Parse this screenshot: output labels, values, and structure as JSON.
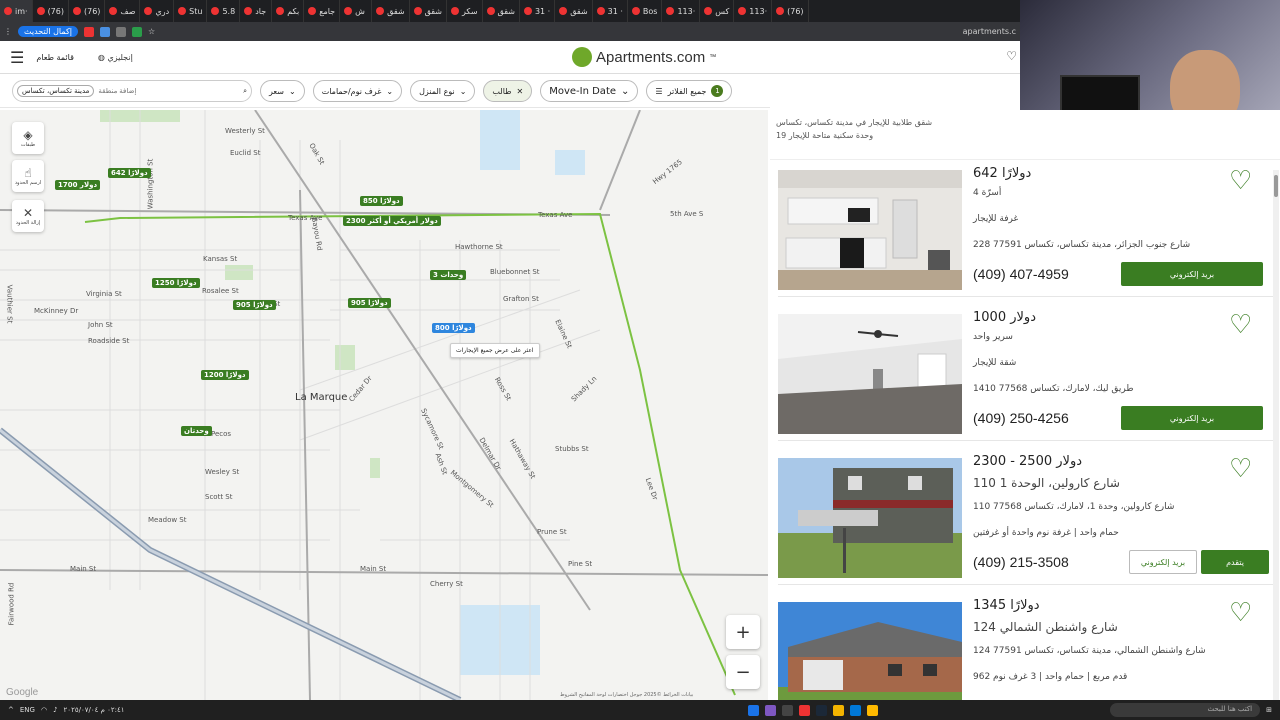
{
  "browser": {
    "tabs": [
      {
        "label": "im·"
      },
      {
        "label": "(76)"
      },
      {
        "label": "(76)"
      },
      {
        "label": "صف"
      },
      {
        "label": "دري"
      },
      {
        "label": "Stu"
      },
      {
        "label": "5.8"
      },
      {
        "label": "جاد"
      },
      {
        "label": "بكم"
      },
      {
        "label": "جامع"
      },
      {
        "label": "ش"
      },
      {
        "label": "شقق"
      },
      {
        "label": "شقق"
      },
      {
        "label": "سكر"
      },
      {
        "label": "شقق"
      },
      {
        "label": "31 ·"
      },
      {
        "label": "شقق"
      },
      {
        "label": "31 ·"
      },
      {
        "label": "Bos"
      },
      {
        "label": "113·"
      },
      {
        "label": "كس"
      },
      {
        "label": "113·"
      },
      {
        "label": "(76)"
      }
    ],
    "update_label": "إكمال التحديث",
    "url": "apartments.c"
  },
  "site": {
    "menu_label": "قائمة طعام",
    "language_label": "إنجليزي",
    "logo_text": "Apartments.com",
    "logo_tm": "™"
  },
  "filters": {
    "search_chip": "مدينة تكساس، تكساس",
    "search_placeholder": "إضافة منطقة",
    "price": "سعر",
    "beds_baths": "غرف نوم/حمامات",
    "home_type": "نوع المنزل",
    "student": "طالب",
    "move_in": "Move-In Date",
    "all_filters": "جميع الفلاتر",
    "all_filters_count": "1"
  },
  "map": {
    "controls": {
      "layers": "طبقات",
      "draw": "ارسم الحدود",
      "remove": "إزالة الحدود"
    },
    "streets": [
      "Hwy 1765",
      "5th Ave S",
      "Texas Ave",
      "Texas Ave",
      "Westerly St",
      "Euclid St",
      "Washington St",
      "Kansas St",
      "Rosalee St",
      "Virginia St",
      "McKinney Dr",
      "John St",
      "Roadside St",
      "Pecos",
      "Oak St",
      "Bayou Rd",
      "Vauthier St",
      "Main St",
      "Main St",
      "Fairwood Rd",
      "Prune St",
      "Cedar Dr",
      "Sycamore St",
      "Montgomery St",
      "Hathaway St",
      "Stubbs St",
      "Ross St",
      "Grafton St",
      "Bluebonnet St",
      "Hawthorne St",
      "Elaine St",
      "Shady Ln",
      "Lee Dr",
      "Pine St",
      "Scott St",
      "Meadow St",
      "Wesley St",
      "Cherry St",
      "Ash St",
      "Delmar Dr",
      "1st St"
    ],
    "city_label": "La Marque",
    "pins": [
      {
        "label": "642 دولارًا",
        "color": "green"
      },
      {
        "label": "1700 دولار",
        "color": "green"
      },
      {
        "label": "850 دولارًا",
        "color": "green"
      },
      {
        "label": "2300 دولار أمريكي أو أكثر",
        "color": "green"
      },
      {
        "label": "3 وحدات",
        "color": "green"
      },
      {
        "label": "1250 دولارًا",
        "color": "green"
      },
      {
        "label": "905 دولارًا",
        "color": "green"
      },
      {
        "label": "905 دولارًا",
        "color": "green"
      },
      {
        "label": "800 دولارًا",
        "color": "blue"
      },
      {
        "label": "1200 دولارًا",
        "color": "green"
      },
      {
        "label": "وحدتان",
        "color": "green"
      }
    ],
    "tooltip": "اعثر على عرض جميع الإيجارات",
    "google": "Google",
    "attribution": "بيانات الخرائط ©2025 جوجل  اختصارات لوحة المفاتيح  الشروط"
  },
  "results": {
    "title": "شقق طلابية للإيجار في مدينة تكساس، تكساس",
    "count": "19 وحدة سكنية متاحة للإيجار"
  },
  "listings": [
    {
      "price": "642 دولارًا",
      "beds": "4 أسرّة",
      "type": "غرفة للإيجار",
      "address": "228 شارع جنوب الجزائر، مدينة تكساس، تكساس 77591",
      "phone": "(409) 407-4959",
      "email": "بريد إلكتروني"
    },
    {
      "price": "1000 دولار",
      "beds": "سرير واحد",
      "type": "شقة للإيجار",
      "address": "1410 طريق ليك، لامارك، تكساس 77568",
      "phone": "(409) 250-4256",
      "email": "بريد إلكتروني"
    },
    {
      "price": "2300 - 2500 دولار",
      "beds": "110 شارع كارولين، الوحدة 1",
      "type": "110 شارع كارولين، وحدة 1، لامارك، تكساس 77568",
      "address": "حمام واحد | غرفة نوم واحدة أو غرفتين",
      "phone": "(409) 215-3508",
      "email": "بريد إلكتروني",
      "apply": "يتقدم"
    },
    {
      "price": "1345 دولارًا",
      "beds": "124 شارع واشنطن الشمالي",
      "type": "124 شارع واشنطن الشمالي، مدينة تكساس، تكساس 77591",
      "address": "962 قدم مربع | حمام واحد | 3 غرف نوم",
      "phone": "",
      "email": ""
    }
  ],
  "taskbar": {
    "search_placeholder": "اكتب هنا للبحث",
    "lang": "ENG",
    "time": "٠٢:٤١ م",
    "date": "٢٠٢٥/٠٧/٠٤"
  },
  "colors": {
    "brand_green": "#3a7d22",
    "pin_blue": "#2e86de",
    "boundary": "#7cc242"
  }
}
